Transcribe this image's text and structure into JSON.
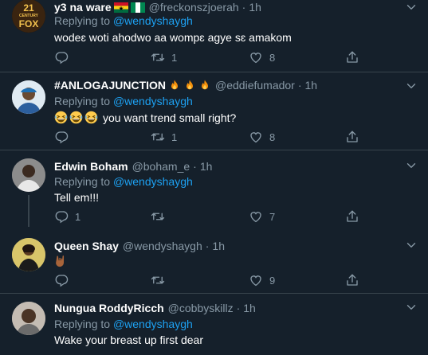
{
  "tweets": [
    {
      "name": "y3 na ware",
      "handle": "@freckonszjoerah",
      "time": "1h",
      "replying_prefix": "Replying to",
      "replying_to": "@wendyshaygh",
      "text": "wodeɛ woti ahodwo aa wompɛ agye sɛ amakom",
      "reply_count": "",
      "retweet_count": "1",
      "like_count": "8"
    },
    {
      "name": "#ANLOGAJUNCTION",
      "handle": "@eddiefumador",
      "time": "1h",
      "replying_prefix": "Replying to",
      "replying_to": "@wendyshaygh",
      "text": "you want trend small right?",
      "reply_count": "",
      "retweet_count": "1",
      "like_count": "8"
    },
    {
      "name": "Edwin Boham",
      "handle": "@boham_e",
      "time": "1h",
      "replying_prefix": "Replying to",
      "replying_to": "@wendyshaygh",
      "text": "Tell em!!!",
      "reply_count": "1",
      "retweet_count": "",
      "like_count": "7"
    },
    {
      "name": "Queen Shay",
      "handle": "@wendyshaygh",
      "time": "1h",
      "text": "",
      "reply_count": "",
      "retweet_count": "",
      "like_count": "9"
    },
    {
      "name": "Nungua RoddyRicch",
      "handle": "@cobbyskillz",
      "time": "1h",
      "replying_prefix": "Replying to",
      "replying_to": "@wendyshaygh",
      "text": "Wake your breast up first dear"
    }
  ],
  "avatar_labels": {
    "t1_line1": "21",
    "t1_line2": "CENTURY",
    "t1_line3": "FOX"
  },
  "icons": [
    "reply-icon",
    "retweet-icon",
    "like-icon",
    "share-icon",
    "chevron-down-icon"
  ],
  "colors": {
    "background": "#15202b",
    "text": "#ffffff",
    "muted": "#8899a6",
    "link": "#1da1f2",
    "divider": "#38444d"
  }
}
